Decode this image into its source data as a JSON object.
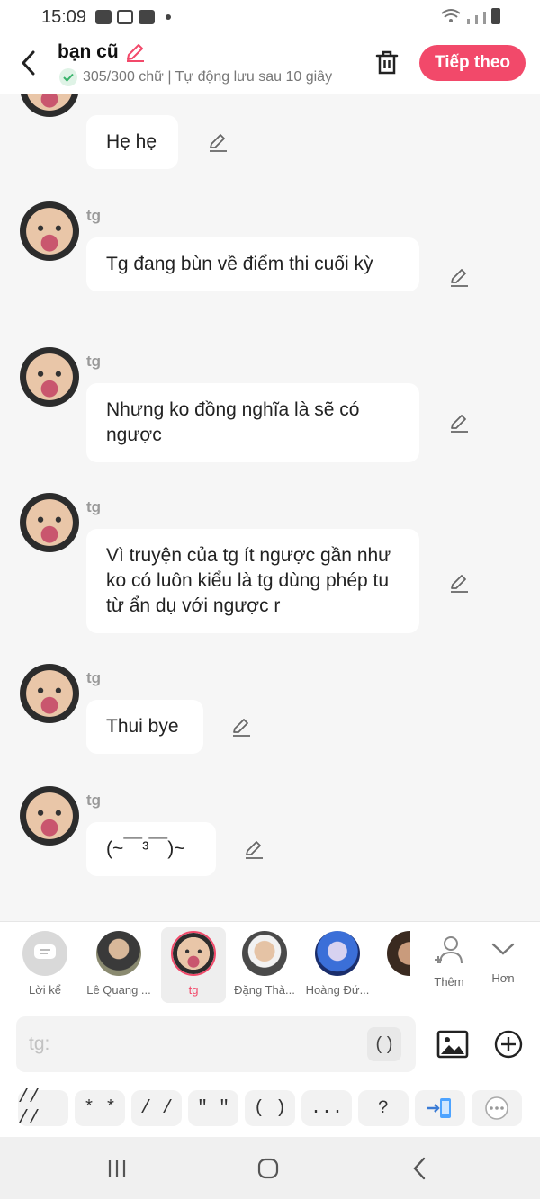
{
  "status_bar": {
    "time": "15:09"
  },
  "header": {
    "title": "bạn cũ",
    "subtitle": "305/300 chữ | Tự động lưu sau 10 giây",
    "next_label": "Tiếp theo"
  },
  "messages": [
    {
      "sender": "tg",
      "text": "Hẹ hẹ"
    },
    {
      "sender": "tg",
      "text": "Tg đang bùn về điểm thi cuối kỳ"
    },
    {
      "sender": "tg",
      "text": "Nhưng ko đồng nghĩa là sẽ có ngược"
    },
    {
      "sender": "tg",
      "text": "Vì truyện của tg ít ngược gần như ko có luôn kiểu là tg dùng phép tu từ ẩn dụ với ngược r"
    },
    {
      "sender": "tg",
      "text": "Thui bye"
    },
    {
      "sender": "tg",
      "text": "(~￣³￣)~"
    }
  ],
  "characters": [
    {
      "name": "Lời kể",
      "selected": false
    },
    {
      "name": "Lê Quang ...",
      "selected": false
    },
    {
      "name": "tg",
      "selected": true
    },
    {
      "name": "Đặng Thà...",
      "selected": false
    },
    {
      "name": "Hoàng Đứ...",
      "selected": false
    },
    {
      "name": "Thêm",
      "selected": false
    },
    {
      "name": "Hơn",
      "selected": false
    }
  ],
  "input": {
    "placeholder": "tg:",
    "paren_label": "( )"
  },
  "symbols": [
    "// //",
    "* *",
    "/ /",
    "\" \"",
    "( )",
    "..."
  ],
  "symbol_question": "?",
  "colors": {
    "accent": "#f2496a",
    "background": "#f6f6f6",
    "bubble": "#ffffff"
  }
}
